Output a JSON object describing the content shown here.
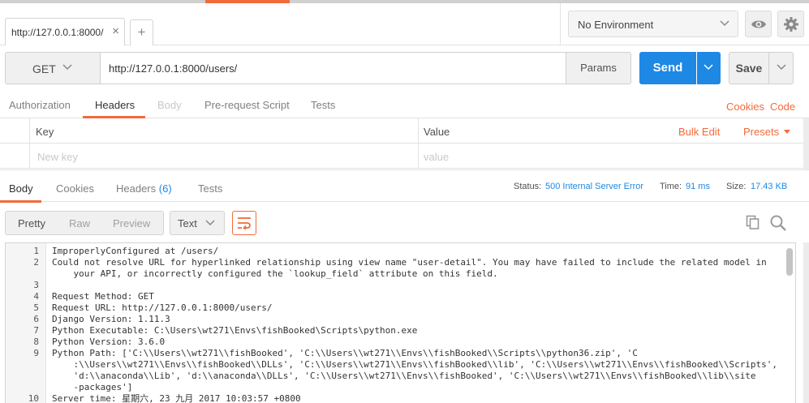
{
  "colors": {
    "accent": "#f26b3a",
    "primary": "#1e88e5",
    "error_status": "#1e88e5"
  },
  "tabs": [
    {
      "label": "http://127.0.0.1:8000/",
      "close": "×"
    }
  ],
  "tab_add_label": "+",
  "environment": {
    "selected": "No Environment",
    "icons": [
      "eye-icon",
      "gear-icon"
    ]
  },
  "request": {
    "method": "GET",
    "url": "http://127.0.0.1:8000/users/",
    "params_label": "Params",
    "send_label": "Send",
    "save_label": "Save"
  },
  "request_tabs": {
    "items": [
      "Authorization",
      "Headers",
      "Body",
      "Pre-request Script",
      "Tests"
    ],
    "active": "Headers",
    "cookies_link": "Cookies",
    "code_link": "Code"
  },
  "headers_table": {
    "key_header": "Key",
    "value_header": "Value",
    "bulk_edit": "Bulk Edit",
    "presets": "Presets",
    "key_placeholder": "New key",
    "value_placeholder": "value"
  },
  "response_tabs": {
    "body": "Body",
    "cookies": "Cookies",
    "headers": "Headers",
    "headers_count": "(6)",
    "tests": "Tests",
    "active": "Body"
  },
  "status": {
    "status_label": "Status:",
    "status_value": "500 Internal Server Error",
    "time_label": "Time:",
    "time_value": "91 ms",
    "size_label": "Size:",
    "size_value": "17.43 KB"
  },
  "response_toolbar": {
    "formats": [
      "Pretty",
      "Raw",
      "Preview"
    ],
    "active_format": "Pretty",
    "type": "Text",
    "icons": [
      "wrap-lines-icon",
      "copy-icon",
      "search-icon"
    ]
  },
  "code_lines": [
    {
      "n": "1",
      "text": "ImproperlyConfigured at /users/"
    },
    {
      "n": "2",
      "text": "Could not resolve URL for hyperlinked relationship using view name \"user-detail\". You may have failed to include the related model in"
    },
    {
      "n": "",
      "text": "    your API, or incorrectly configured the `lookup_field` attribute on this field."
    },
    {
      "n": "3",
      "text": ""
    },
    {
      "n": "4",
      "text": "Request Method: GET"
    },
    {
      "n": "5",
      "text": "Request URL: http://127.0.0.1:8000/users/"
    },
    {
      "n": "6",
      "text": "Django Version: 1.11.3"
    },
    {
      "n": "7",
      "text": "Python Executable: C:\\Users\\wt271\\Envs\\fishBooked\\Scripts\\python.exe"
    },
    {
      "n": "8",
      "text": "Python Version: 3.6.0"
    },
    {
      "n": "9",
      "text": "Python Path: ['C:\\\\Users\\\\wt271\\\\fishBooked', 'C:\\\\Users\\\\wt271\\\\Envs\\\\fishBooked\\\\Scripts\\\\python36.zip', 'C"
    },
    {
      "n": "",
      "text": "    :\\\\Users\\\\wt271\\\\Envs\\\\fishBooked\\\\DLLs', 'C:\\\\Users\\\\wt271\\\\Envs\\\\fishBooked\\\\lib', 'C:\\\\Users\\\\wt271\\\\Envs\\\\fishBooked\\\\Scripts',"
    },
    {
      "n": "",
      "text": "    'd:\\\\anaconda\\\\Lib', 'd:\\\\anaconda\\\\DLLs', 'C:\\\\Users\\\\wt271\\\\Envs\\\\fishBooked', 'C:\\\\Users\\\\wt271\\\\Envs\\\\fishBooked\\\\lib\\\\site"
    },
    {
      "n": "",
      "text": "    -packages']"
    },
    {
      "n": "10",
      "text": "Server time: 星期六, 23 九月 2017 10:03:57 +0800"
    }
  ]
}
